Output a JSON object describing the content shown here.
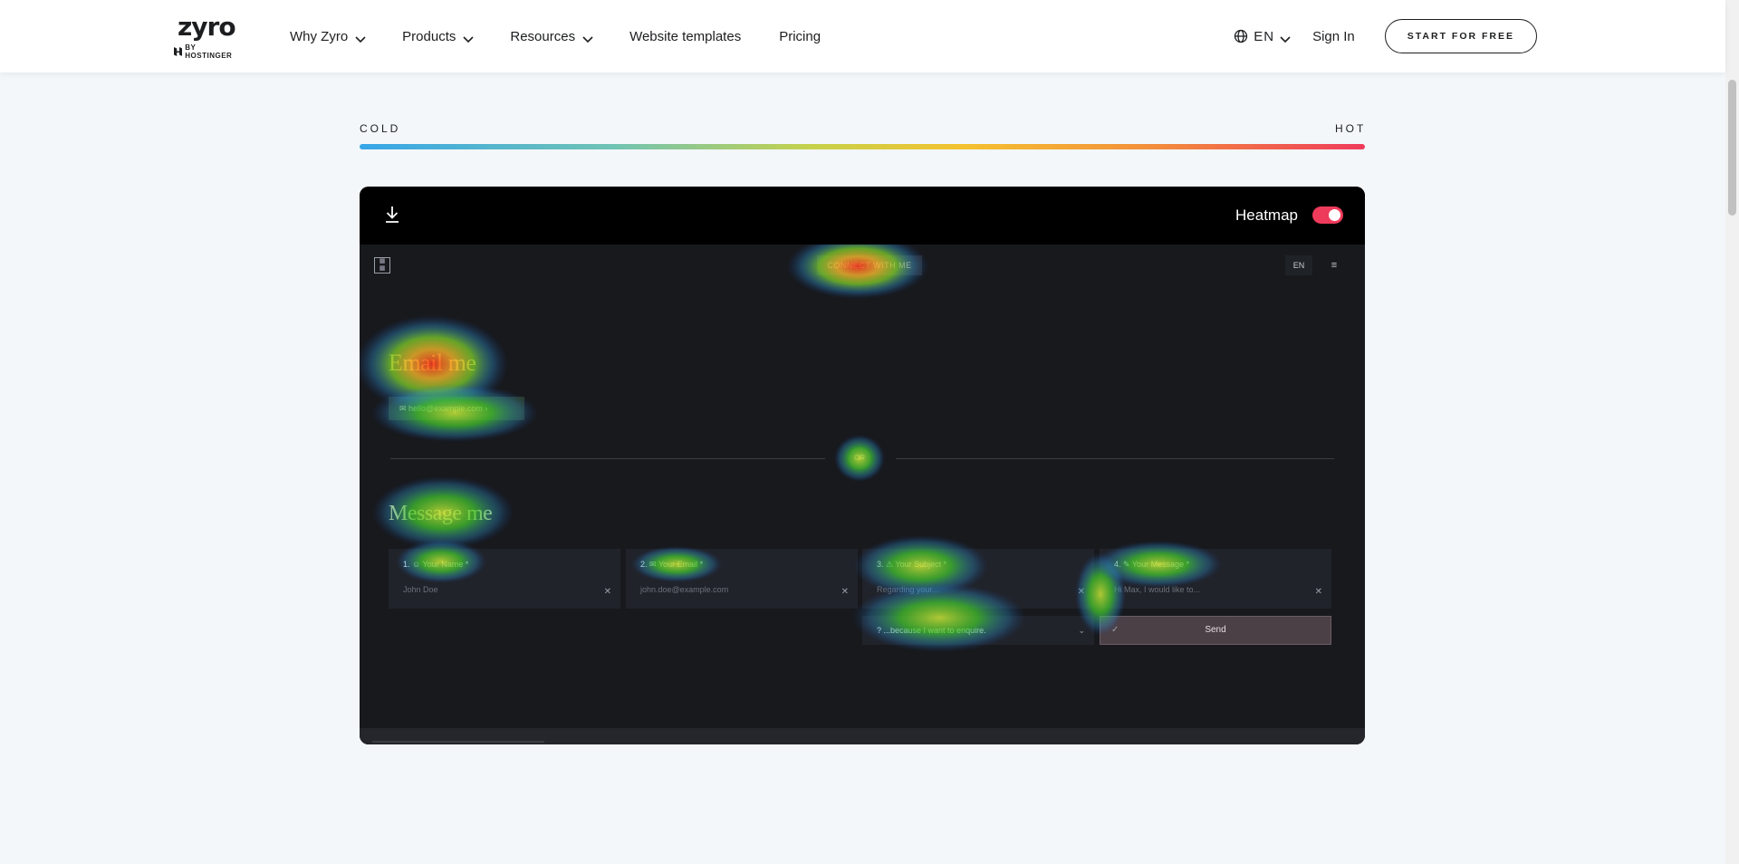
{
  "header": {
    "logo_text": "zyro",
    "logo_sub": "BY HOSTINGER",
    "nav": [
      {
        "label": "Why Zyro",
        "has_dropdown": true
      },
      {
        "label": "Products",
        "has_dropdown": true
      },
      {
        "label": "Resources",
        "has_dropdown": true
      },
      {
        "label": "Website templates",
        "has_dropdown": false
      },
      {
        "label": "Pricing",
        "has_dropdown": false
      }
    ],
    "language": "EN",
    "sign_in": "Sign In",
    "cta": "START FOR FREE"
  },
  "legend": {
    "cold": "COLD",
    "hot": "HOT"
  },
  "preview": {
    "heatmap_label": "Heatmap",
    "heatmap_enabled": true,
    "site": {
      "language": "EN",
      "menu_glyph": "≡",
      "connect_button": "CONNECT WITH ME",
      "email_heading": "Email me",
      "email_address": "✉ hello@example.com  ›",
      "or_label": "OR",
      "message_heading": "Message me",
      "fields": [
        {
          "label": "1.  ☺  Your Name  *",
          "placeholder": "John Doe"
        },
        {
          "label": "2.  ✉  Your Email  *",
          "placeholder": "john.doe@example.com"
        },
        {
          "label": "3.  ⚠  Your Subject  *",
          "placeholder": "Regarding your..."
        },
        {
          "label": "4.  ✎  Your Message  *",
          "placeholder": "Hi Max, I would like to..."
        }
      ],
      "subject_select": "?     ...because I want to enquire.",
      "send_button": "Send"
    }
  },
  "colors": {
    "accent": "#ef3b5b",
    "cold": "#37a6e8",
    "hot": "#ef3b5b"
  }
}
